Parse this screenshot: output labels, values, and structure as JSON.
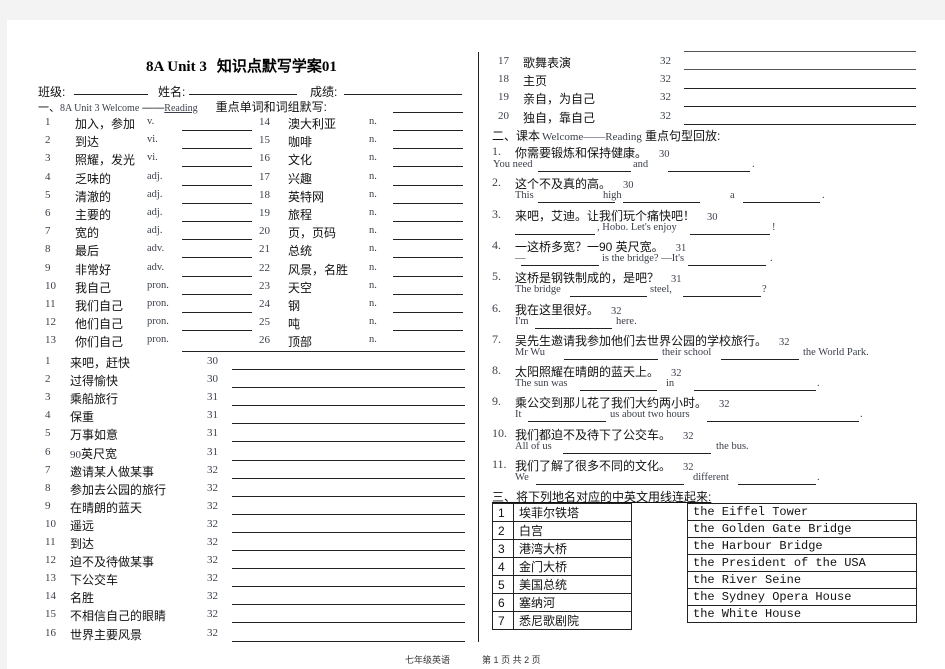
{
  "header": {
    "title_en": "8A  Unit  3",
    "title_cn": "知识点默写学案",
    "title_num": "01",
    "class_label": "班级:",
    "name_label": "姓名:",
    "score_label": "成绩:"
  },
  "section1": {
    "heading_prefix": "一、",
    "heading_en": "8A  Unit  3  Welcome",
    "heading_dash": "——",
    "heading_reading": "Reading",
    "heading_cn": "重点单词和词组默写:",
    "words_left": [
      {
        "num": "1",
        "cn": "加入，参加",
        "pos": "v."
      },
      {
        "num": "2",
        "cn": "到达",
        "pos": "vi."
      },
      {
        "num": "3",
        "cn": "照耀，发光",
        "pos": "vi."
      },
      {
        "num": "4",
        "cn": "乏味的",
        "pos": "adj."
      },
      {
        "num": "5",
        "cn": "清澈的",
        "pos": "adj."
      },
      {
        "num": "6",
        "cn": "主要的",
        "pos": "adj."
      },
      {
        "num": "7",
        "cn": "宽的",
        "pos": "adj."
      },
      {
        "num": "8",
        "cn": "最后",
        "pos": "adv."
      },
      {
        "num": "9",
        "cn": "非常好",
        "pos": "adv."
      },
      {
        "num": "10",
        "cn": "我自己",
        "pos": "pron."
      },
      {
        "num": "11",
        "cn": "我们自己",
        "pos": "pron."
      },
      {
        "num": "12",
        "cn": "他们自己",
        "pos": "pron."
      },
      {
        "num": "13",
        "cn": "你们自己",
        "pos": "pron."
      }
    ],
    "words_right": [
      {
        "num": "14",
        "cn": "澳大利亚",
        "pos": "n."
      },
      {
        "num": "15",
        "cn": "咖啡",
        "pos": "n."
      },
      {
        "num": "16",
        "cn": "文化",
        "pos": "n."
      },
      {
        "num": "17",
        "cn": "兴趣",
        "pos": "n."
      },
      {
        "num": "18",
        "cn": "英特网",
        "pos": "n."
      },
      {
        "num": "19",
        "cn": "旅程",
        "pos": "n."
      },
      {
        "num": "20",
        "cn": "页，页码",
        "pos": "n."
      },
      {
        "num": "21",
        "cn": "总统",
        "pos": "n."
      },
      {
        "num": "22",
        "cn": "风景，名胜",
        "pos": "n."
      },
      {
        "num": "23",
        "cn": "天空",
        "pos": "n."
      },
      {
        "num": "24",
        "cn": "钢",
        "pos": "n."
      },
      {
        "num": "25",
        "cn": "吨",
        "pos": "n."
      },
      {
        "num": "26",
        "cn": "顶部",
        "pos": "n."
      }
    ],
    "phrases": [
      {
        "num": "1",
        "cn": "来吧，赶快",
        "page": "30"
      },
      {
        "num": "2",
        "cn": "过得愉快",
        "page": "30"
      },
      {
        "num": "3",
        "cn": "乘船旅行",
        "page": "31"
      },
      {
        "num": "4",
        "cn": "保重",
        "page": "31"
      },
      {
        "num": "5",
        "cn": "万事如意",
        "page": "31"
      },
      {
        "num": "6",
        "cn_num": "90",
        "cn": "英尺宽",
        "page": "31"
      },
      {
        "num": "7",
        "cn": "邀请某人做某事",
        "page": "32"
      },
      {
        "num": "8",
        "cn": "参加去公园的旅行",
        "page": "32"
      },
      {
        "num": "9",
        "cn": "在晴朗的蓝天",
        "page": "32"
      },
      {
        "num": "10",
        "cn": "遥远",
        "page": "32"
      },
      {
        "num": "11",
        "cn": "到达",
        "page": "32"
      },
      {
        "num": "12",
        "cn": "迫不及待做某事",
        "page": "32"
      },
      {
        "num": "13",
        "cn": "下公交车",
        "page": "32"
      },
      {
        "num": "14",
        "cn": "名胜",
        "page": "32"
      },
      {
        "num": "15",
        "cn": "不相信自己的眼睛",
        "page": "32"
      },
      {
        "num": "16",
        "cn": "世界主要风景",
        "page": "32"
      },
      {
        "num": "17",
        "cn": "歌舞表演",
        "page": "32"
      },
      {
        "num": "18",
        "cn": "主页",
        "page": "32"
      },
      {
        "num": "19",
        "cn": "亲自，为自己",
        "page": "32"
      },
      {
        "num": "20",
        "cn": "独自，靠自己",
        "page": "32"
      }
    ]
  },
  "section2": {
    "heading_prefix": "二、课本",
    "heading_en": "Welcome——Reading",
    "heading_cn": "重点句型回放:",
    "sentences": [
      {
        "num": "1.",
        "cn": "你需要锻炼和保持健康。",
        "page": "30",
        "en": [
          "You  need",
          "and",
          "."
        ]
      },
      {
        "num": "2.",
        "cn": "这个不及真的高。",
        "page": "30",
        "en": [
          "This",
          "high",
          "a",
          "."
        ]
      },
      {
        "num": "3.",
        "cn": "来吧，艾迪。让我们玩个痛快吧！",
        "page": "30",
        "en": [
          ", Hobo.  Let's  enjoy",
          "!"
        ]
      },
      {
        "num": "4.",
        "cn": "一这桥多宽？一90 英尺宽。",
        "page": "31",
        "en": [
          "—",
          "is  the  bridge?   —It's",
          "."
        ]
      },
      {
        "num": "5.",
        "cn": "这桥是钢铁制成的，是吧？",
        "page": "31",
        "en": [
          "The  bridge",
          "steel,",
          "?"
        ]
      },
      {
        "num": "6.",
        "cn": "我在这里很好。",
        "page": "32",
        "en": [
          "I'm",
          "here."
        ]
      },
      {
        "num": "7.",
        "cn": "吴先生邀请我参加他们去世界公园的学校旅行。",
        "page": "32",
        "en": [
          "Mr  Wu",
          "their  school",
          "the  World  Park."
        ]
      },
      {
        "num": "8.",
        "cn": "太阳照耀在晴朗的蓝天上。",
        "page": "32",
        "en": [
          "The  sun  was",
          "in",
          "."
        ]
      },
      {
        "num": "9.",
        "cn": "乘公交到那儿花了我们大约两小时。",
        "page": "32",
        "en": [
          "It",
          "us  about  two  hours",
          "."
        ]
      },
      {
        "num": "10.",
        "cn": "我们都迫不及待下了公交车。",
        "page": "32",
        "en": [
          "All  of  us",
          "the  bus."
        ]
      },
      {
        "num": "11.",
        "cn": "我们了解了很多不同的文化。",
        "page": "32",
        "en": [
          "We",
          "different",
          "."
        ]
      }
    ]
  },
  "section3": {
    "heading": "三、将下列地名对应的中英文用线连起来:",
    "left": [
      {
        "num": "1",
        "cn": "埃菲尔铁塔"
      },
      {
        "num": "2",
        "cn": "白宫"
      },
      {
        "num": "3",
        "cn": "港湾大桥"
      },
      {
        "num": "4",
        "cn": "金门大桥"
      },
      {
        "num": "5",
        "cn": "美国总统"
      },
      {
        "num": "6",
        "cn": "塞纳河"
      },
      {
        "num": "7",
        "cn": "悉尼歌剧院"
      }
    ],
    "right": [
      "the Eiffel Tower",
      "the Golden Gate Bridge",
      "the Harbour Bridge",
      "the President of the USA",
      "the River Seine",
      "the Sydney Opera House",
      "the White House"
    ]
  },
  "footer": {
    "subject": "七年级英语",
    "page_prefix": "第",
    "page_current": "1",
    "page_mid": "页  共",
    "page_total": "2",
    "page_suffix": "页"
  }
}
